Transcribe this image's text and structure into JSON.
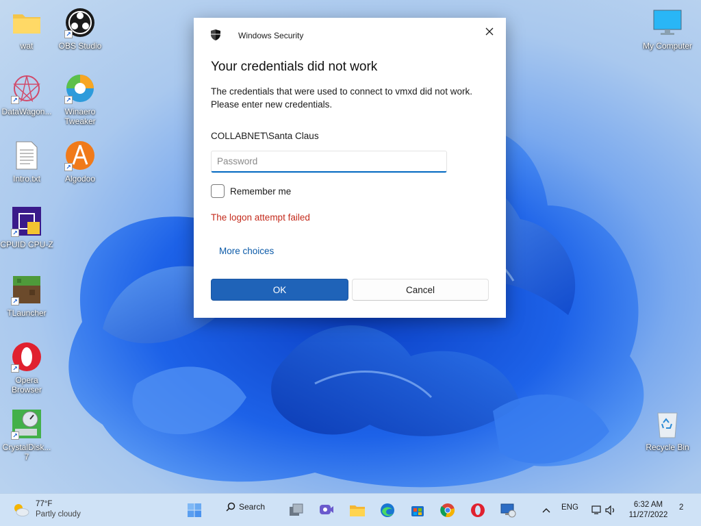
{
  "desktop": {
    "icons": [
      {
        "label": "wat"
      },
      {
        "label": "OBS Studio"
      },
      {
        "label": "DataWagon..."
      },
      {
        "label": "Winaero Tweaker"
      },
      {
        "label": "Intro.txt"
      },
      {
        "label": "Algodoo"
      },
      {
        "label": "CPUID CPU-Z"
      },
      {
        "label": "TLauncher"
      },
      {
        "label": "Opera Browser"
      },
      {
        "label": "CrystalDisk... 7"
      },
      {
        "label": "My Computer"
      },
      {
        "label": "Recycle Bin"
      }
    ]
  },
  "dialog": {
    "app_title": "Windows Security",
    "heading": "Your credentials did not work",
    "message_line1": "The credentials that were used to connect to vmxd did not work.",
    "message_line2": "Please enter new credentials.",
    "username": "COLLABNET\\Santa Claus",
    "password_placeholder": "Password",
    "password_value": "",
    "remember_label": "Remember me",
    "remember_checked": false,
    "error": "The logon attempt failed",
    "more_choices": "More choices",
    "ok_label": "OK",
    "cancel_label": "Cancel",
    "accent_color": "#1f63b8",
    "error_color": "#c42b1c"
  },
  "taskbar": {
    "weather_temp": "77°F",
    "weather_desc": "Partly cloudy",
    "search_label": "Search",
    "language": "ENG",
    "time": "6:32 AM",
    "date": "11/27/2022",
    "notification_count": "2"
  }
}
